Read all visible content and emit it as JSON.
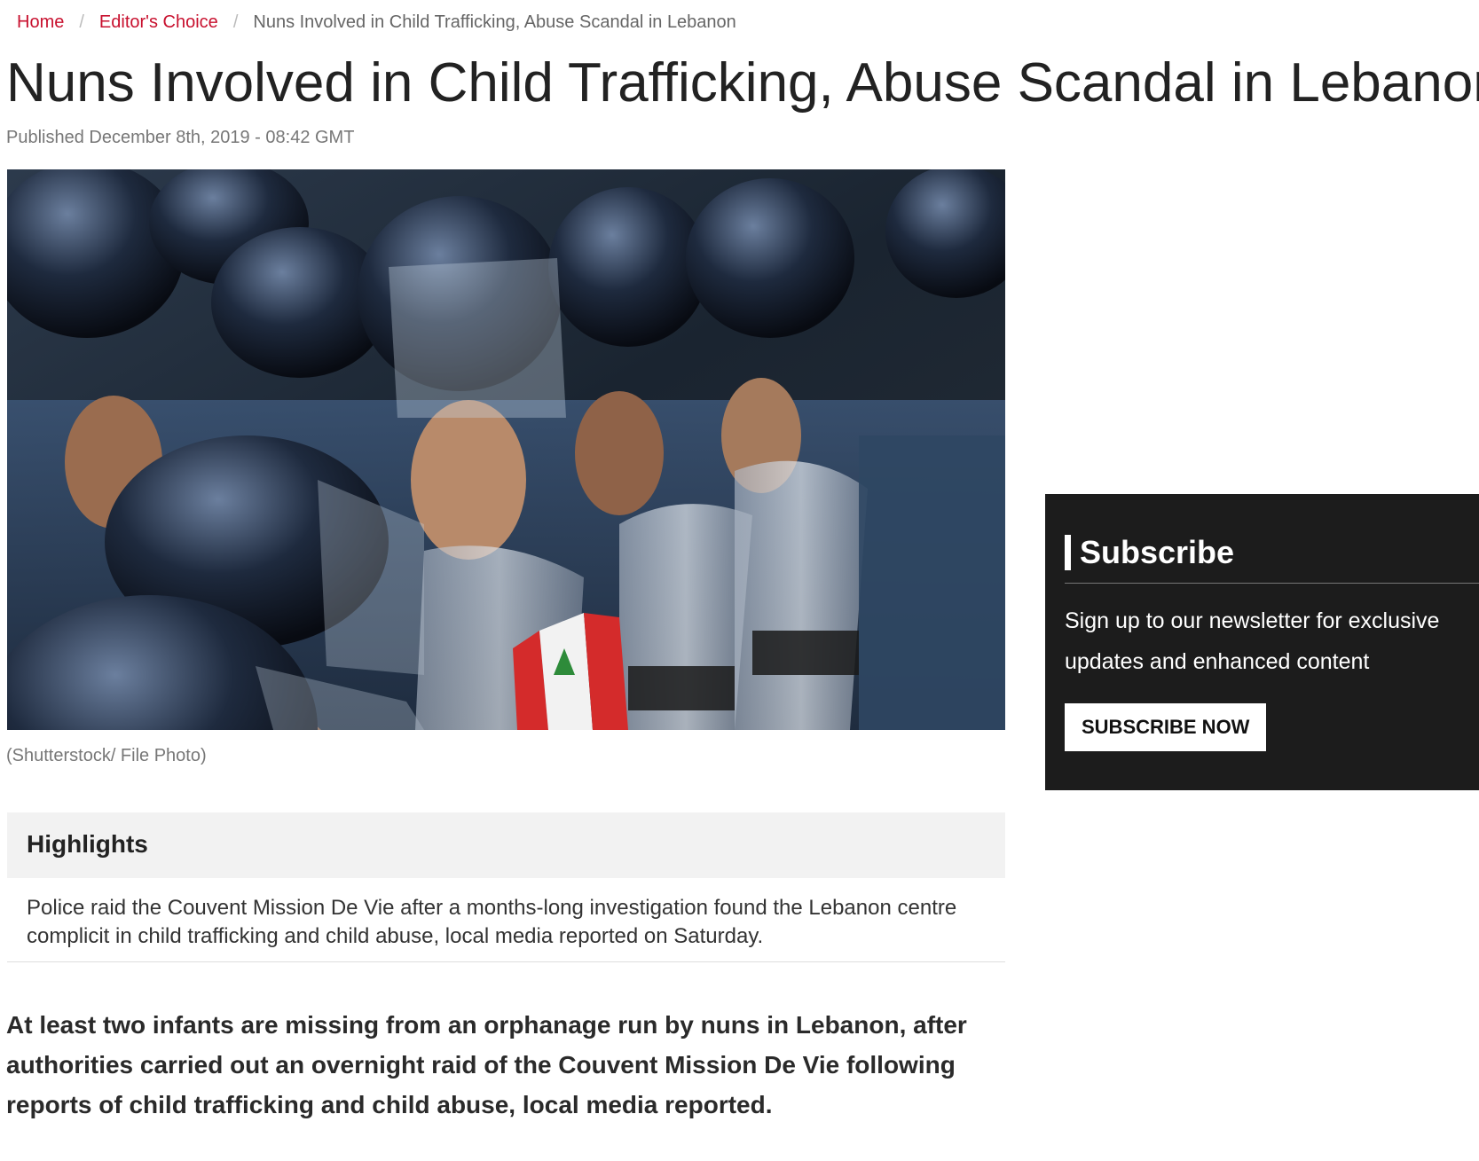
{
  "breadcrumb": {
    "home": "Home",
    "section": "Editor's Choice",
    "current": "Nuns Involved in Child Trafficking, Abuse Scandal in Lebanon"
  },
  "article": {
    "title": "Nuns Involved in Child Trafficking, Abuse Scandal in Lebanon",
    "published": "Published December 8th, 2019 - 08:42 GMT",
    "image_caption": "(Shutterstock/ File Photo)",
    "highlights_heading": "Highlights",
    "highlights_text": "Police raid the Couvent Mission De Vie after a months-long investigation found the Lebanon centre complicit in child trafficking and child abuse, local media reported on Saturday.",
    "lead": "At least two infants are missing from an orphanage run by nuns in Lebanon, after authorities carried out an overnight raid of the Couvent Mission De Vie following reports of child trafficking and child abuse, local media reported."
  },
  "subscribe": {
    "title": "Subscribe",
    "text": "Sign up to our newsletter for exclusive updates and enhanced content",
    "button": "SUBSCRIBE NOW"
  },
  "colors": {
    "link": "#c8102e",
    "panel_bg": "#1c1c1c",
    "highlights_bg": "#f2f2f2"
  }
}
